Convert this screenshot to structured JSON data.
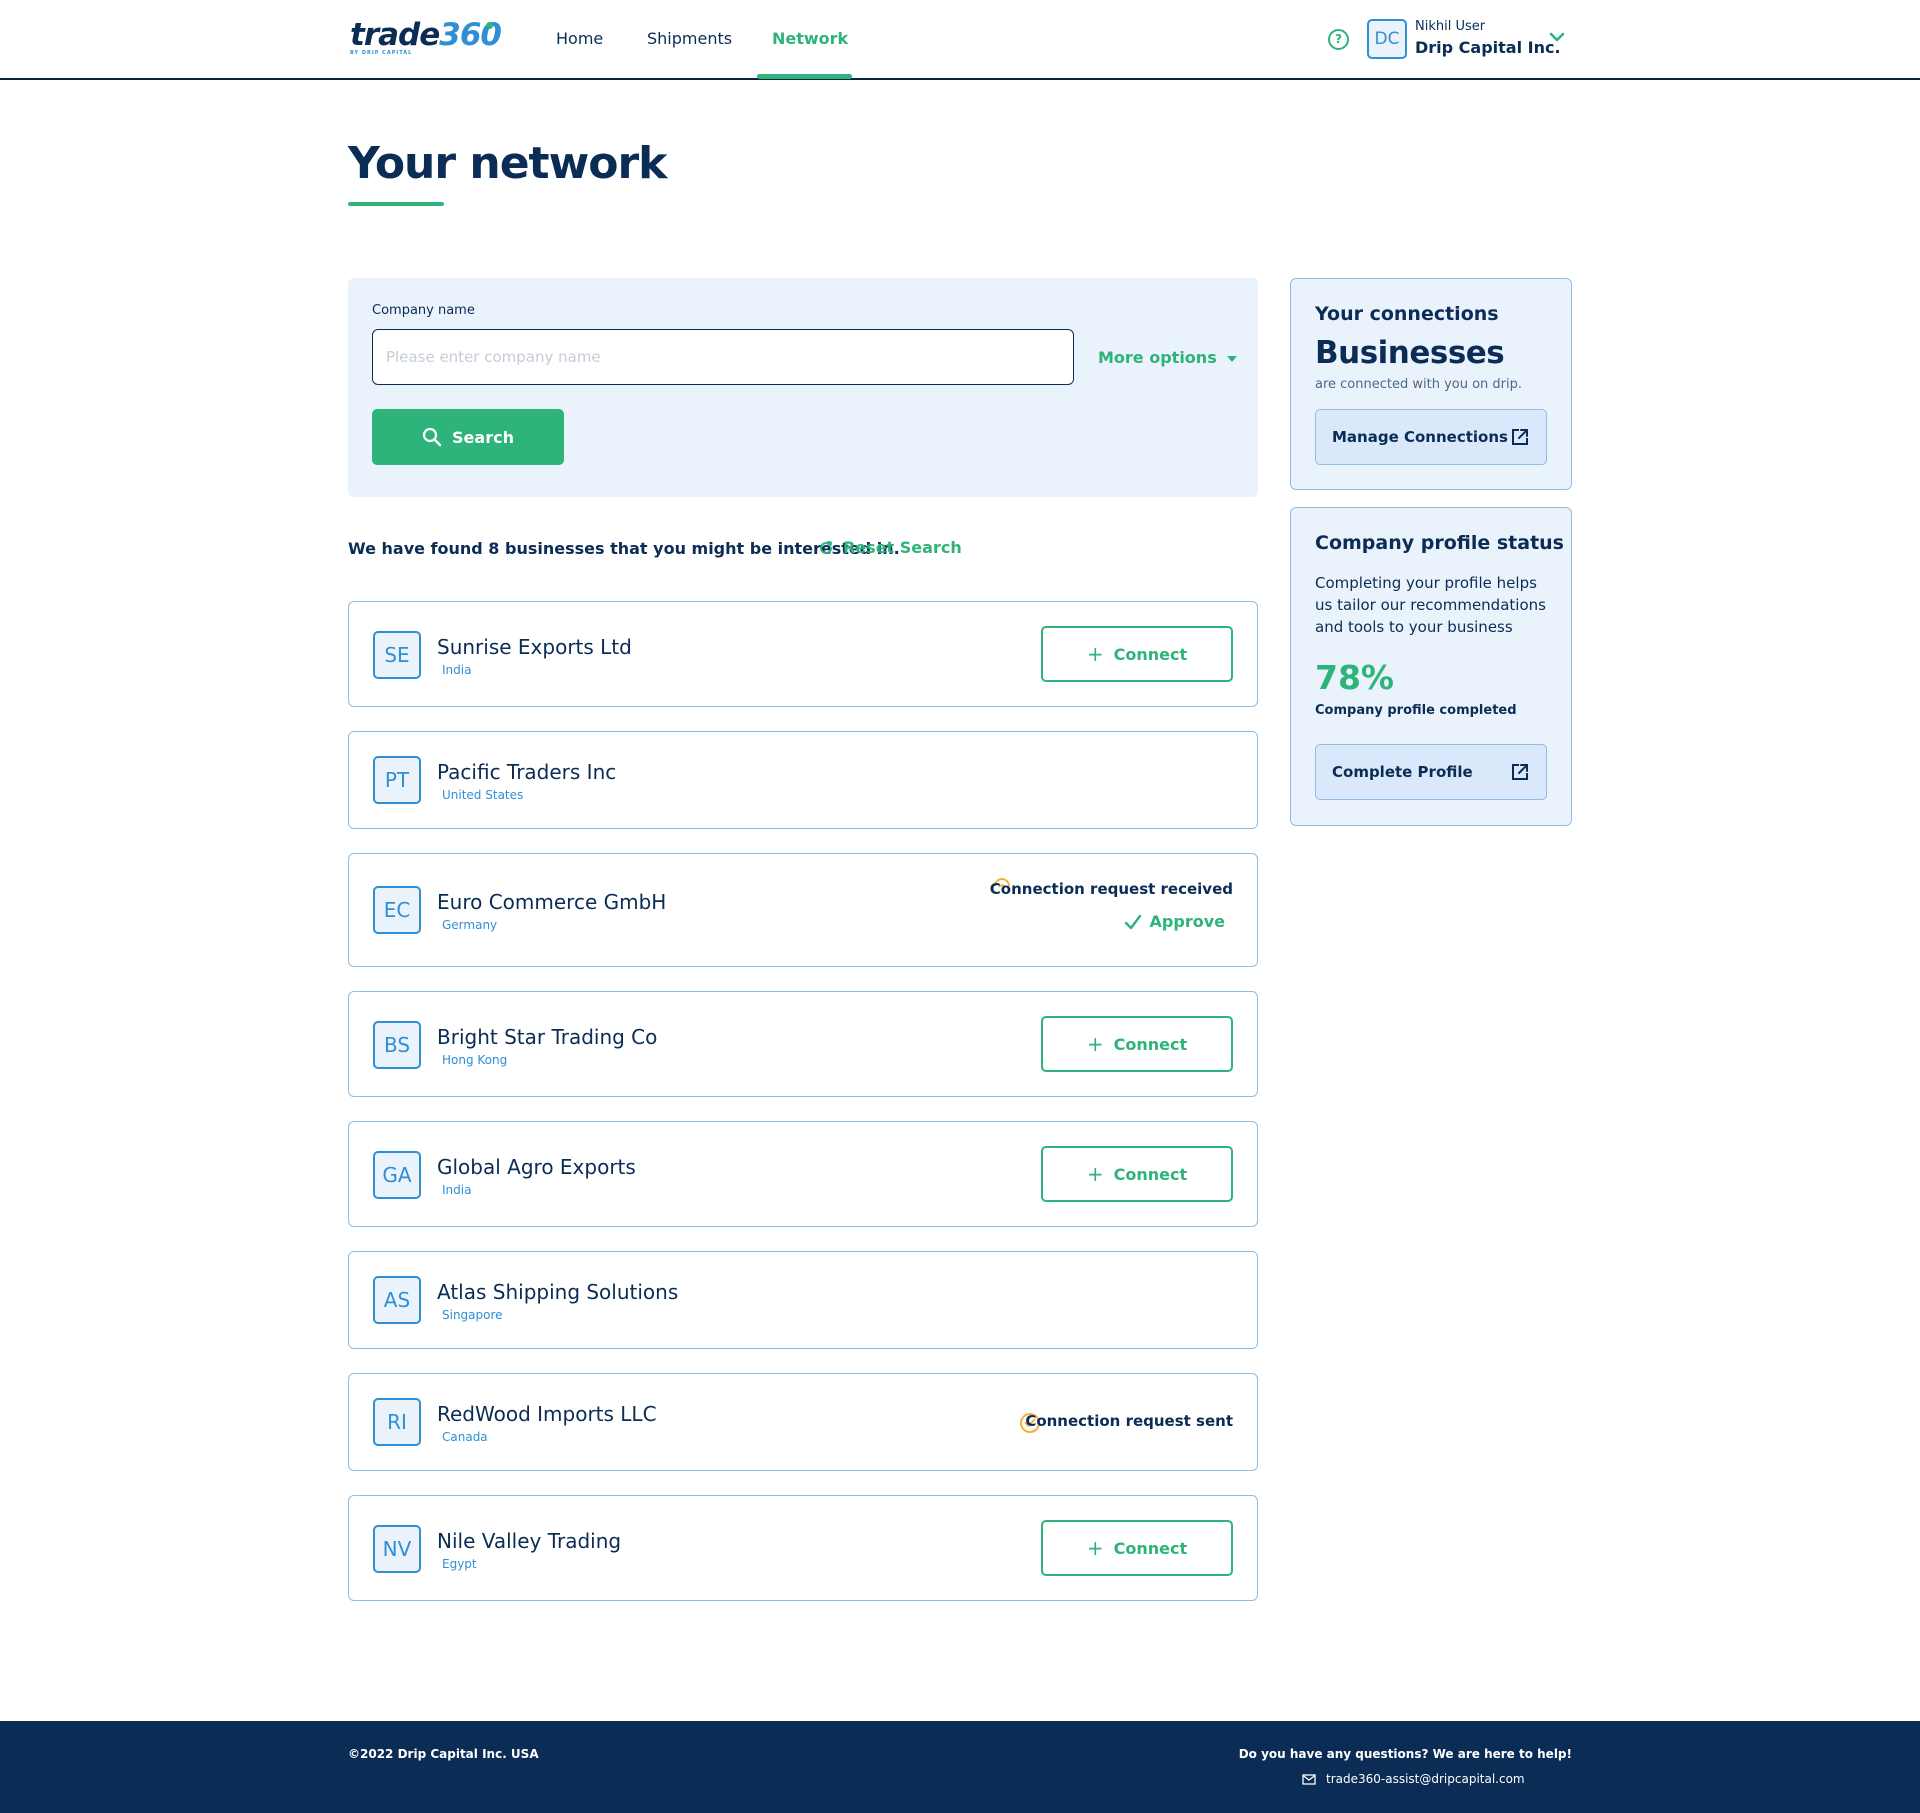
{
  "header": {
    "logo": {
      "main": "trade",
      "number": "360",
      "sub": "BY DRIP CAPITAL"
    },
    "nav": [
      {
        "label": "Home",
        "active": false
      },
      {
        "label": "Shipments",
        "active": false
      },
      {
        "label": "Network",
        "active": true
      }
    ],
    "user": {
      "initials": "DC",
      "name": "Nikhil User",
      "company": "Drip Capital Inc."
    },
    "icons": {
      "help": "help-circle-icon",
      "dropdown": "chevron-down-icon"
    }
  },
  "page": {
    "title": "Your network"
  },
  "search": {
    "label": "Company name",
    "placeholder": "Please enter company name",
    "value": "",
    "more_options": "More options",
    "button": "Search"
  },
  "results": {
    "summary": "We have found 8 businesses that you might be interested in.",
    "reset": "Reset Search",
    "items": [
      {
        "initials": "SE",
        "name": "Sunrise Exports Ltd",
        "country": "India",
        "action": "Connect"
      },
      {
        "initials": "PT",
        "name": "Pacific Traders Inc",
        "country": "United States",
        "action": ""
      },
      {
        "initials": "EC",
        "name": "Euro Commerce GmbH",
        "country": "Germany",
        "status": "Connection request received",
        "action": "Approve"
      },
      {
        "initials": "BS",
        "name": "Bright Star Trading Co",
        "country": "Hong Kong",
        "action": "Connect"
      },
      {
        "initials": "GA",
        "name": "Global Agro Exports",
        "country": "India",
        "action": "Connect"
      },
      {
        "initials": "AS",
        "name": "Atlas Shipping Solutions",
        "country": "Singapore",
        "action": ""
      },
      {
        "initials": "RI",
        "name": "RedWood Imports LLC",
        "country": "Canada",
        "status": "Connection request sent",
        "action": ""
      },
      {
        "initials": "NV",
        "name": "Nile Valley Trading",
        "country": "Egypt",
        "action": "Connect"
      }
    ]
  },
  "connections": {
    "title": "Your connections",
    "big": "Businesses",
    "caption": "are connected with you on drip.",
    "button": "Manage Connections"
  },
  "profile": {
    "title": "Company profile status",
    "description": "Completing your profile helps us tailor our recommendations and tools to your business",
    "percent": "78%",
    "percent_value": 0.78,
    "caption": "Company profile completed",
    "button": "Complete Profile"
  },
  "footer": {
    "copyright": "©2022 Drip Capital Inc. USA",
    "help": "Do you have any questions? We are here to help!",
    "email": "trade360-assist@dripcapital.com"
  },
  "colors": {
    "primary": "#0b2c55",
    "accent": "#2eb37a",
    "link": "#2f8fd4",
    "panel": "#eaf3fc",
    "pending": "#f3b13f"
  }
}
